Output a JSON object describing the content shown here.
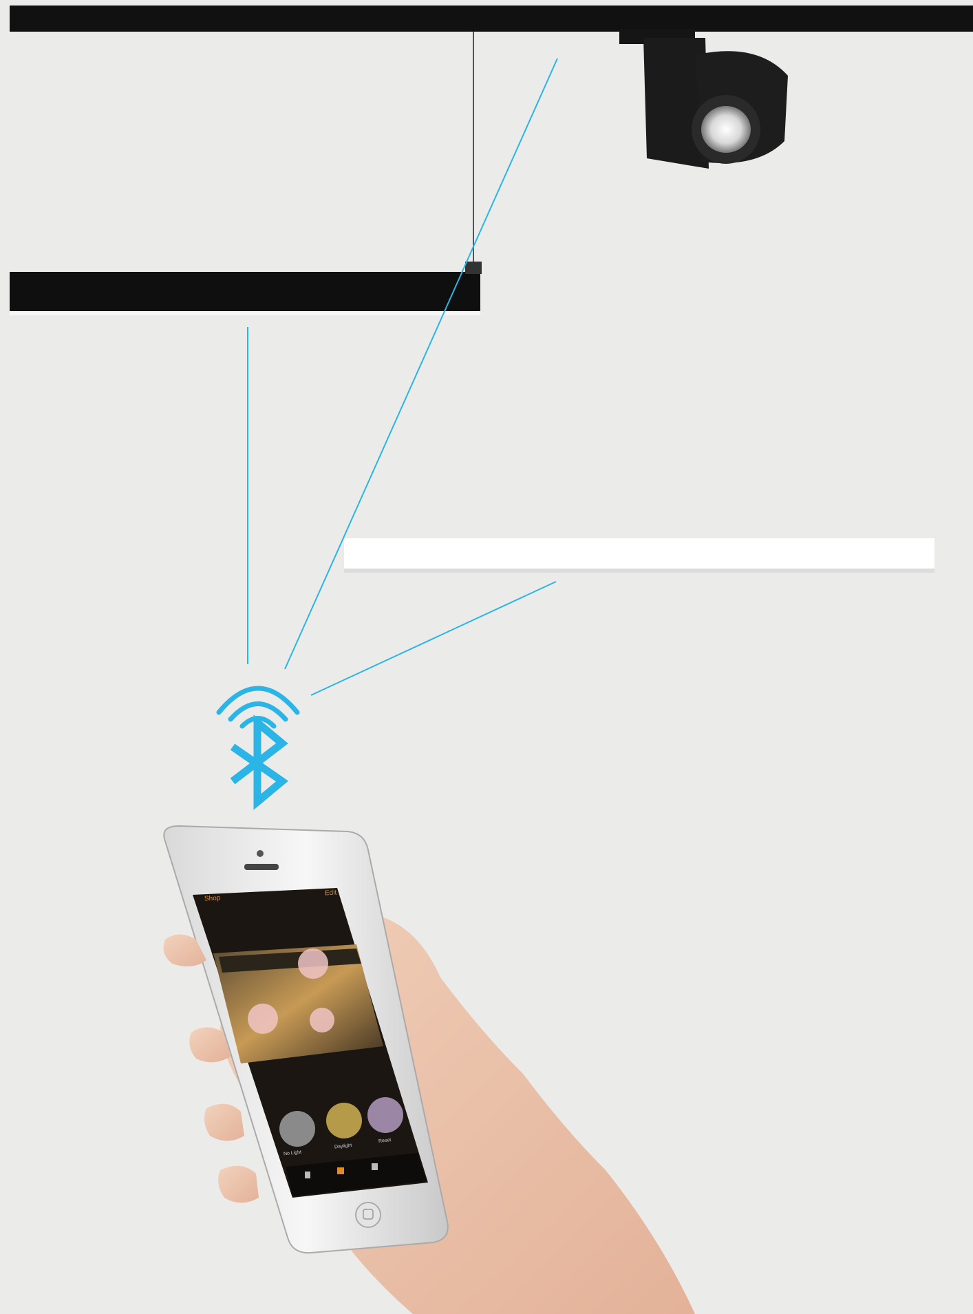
{
  "scene": {
    "background": "#ebebea",
    "signal_color": "#2bb4e6",
    "fixture_color": "#111111",
    "white_fixture_color": "#ffffff"
  },
  "app": {
    "header_left": "Shop",
    "header_right": "Edit",
    "scenes": [
      {
        "label": "No Light",
        "color": "#8a8a8a"
      },
      {
        "label": "Daylight",
        "color": "#b59a4a"
      },
      {
        "label": "Reset",
        "color": "#9b86a6"
      }
    ]
  },
  "icons": [
    "wifi-signal-icon",
    "bluetooth-icon"
  ]
}
